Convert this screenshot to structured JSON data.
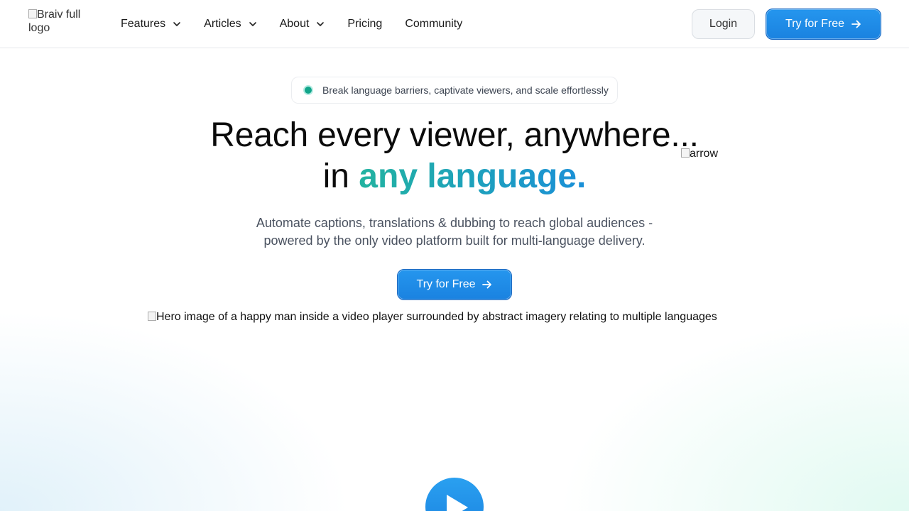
{
  "header": {
    "logo_alt": "Braiv full logo",
    "nav": [
      {
        "label": "Features",
        "has_dropdown": true,
        "icon": "chevron-down-icon"
      },
      {
        "label": "Articles",
        "has_dropdown": true,
        "icon": "chevron-down-icon"
      },
      {
        "label": "About",
        "has_dropdown": true,
        "icon": "chevron-down-icon"
      },
      {
        "label": "Pricing",
        "has_dropdown": false
      },
      {
        "label": "Community",
        "has_dropdown": false
      }
    ],
    "login_label": "Login",
    "try_label": "Try for Free"
  },
  "hero": {
    "pill_text": "Break language barriers, captivate viewers, and scale effortlessly",
    "headline_line1": "Reach every viewer, anywhere...",
    "headline_line2_prefix": "in ",
    "headline_line2_accent": "any language.",
    "arrow_alt": "arrow",
    "subtext_line1": "Automate captions, translations & dubbing to reach global audiences -",
    "subtext_line2": "powered by the only video platform built for multi-language delivery.",
    "cta_label": "Try for Free",
    "hero_image_alt": "Hero image of a happy man inside a video player surrounded by abstract imagery relating to multiple languages",
    "play_icon": "play-icon"
  },
  "colors": {
    "primary": "#1a82e0",
    "accent_start": "#22b3a0",
    "accent_end": "#1a8fd8",
    "status_dot": "#12a58a"
  }
}
